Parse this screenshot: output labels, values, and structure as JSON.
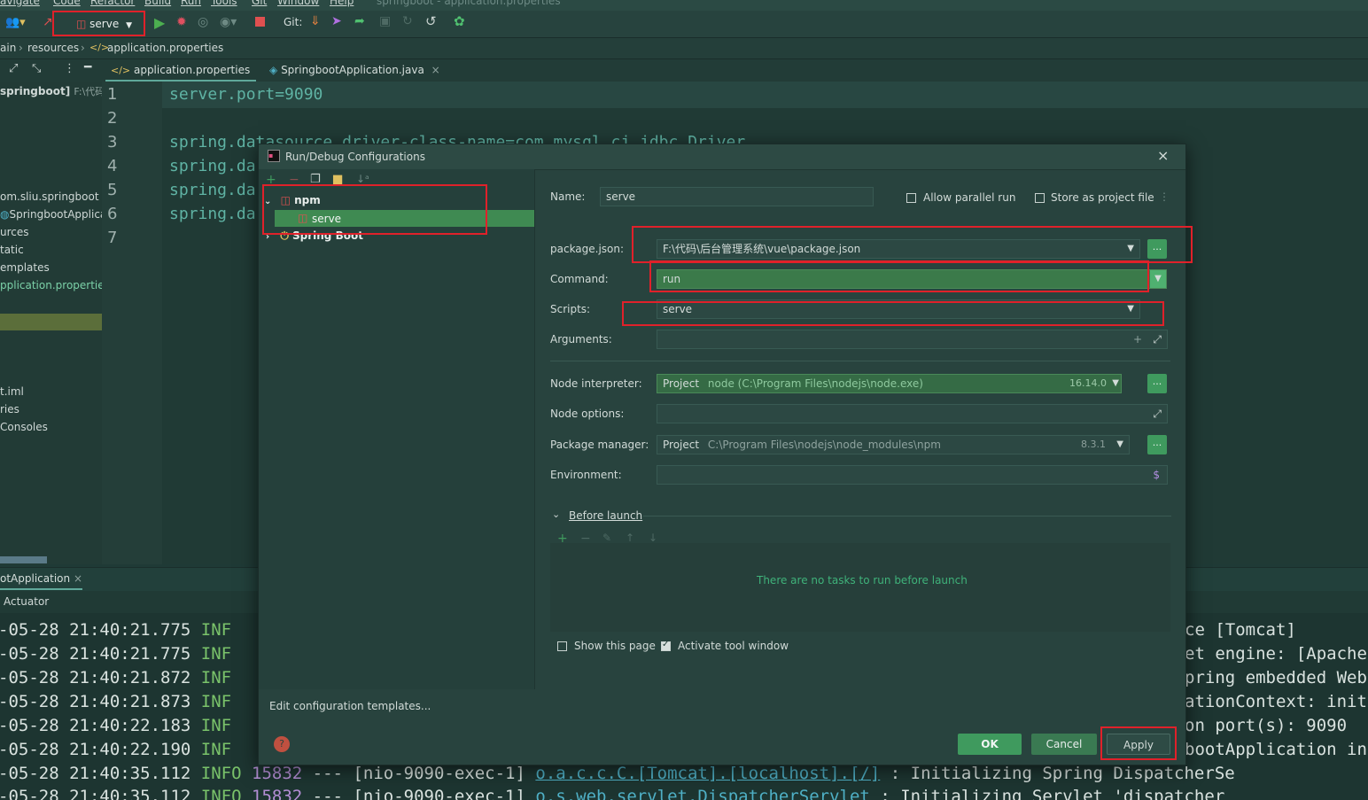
{
  "menubar": {
    "items": [
      "avigate",
      "Code",
      "Refactor",
      "Build",
      "Run",
      "Tools",
      "Git",
      "Window",
      "Help"
    ],
    "title": "springboot - application.properties"
  },
  "toolbar": {
    "run_config": "serve",
    "git_label": "Git:"
  },
  "breadcrumb": [
    "ain",
    "resources",
    "application.properties"
  ],
  "editor_tabs": [
    {
      "label": "application.properties",
      "active": true
    },
    {
      "label": "SpringbootApplication.java",
      "active": false
    }
  ],
  "project_tree": {
    "root": "springboot]",
    "root_path": "F:\\代码",
    "items": [
      "om.sliu.springboot",
      "SpringbootApplica",
      "urces",
      "tatic",
      "emplates",
      "pplication.propertie",
      "t.iml",
      "ries",
      " Consoles"
    ]
  },
  "editor": {
    "line_numbers": [
      "1",
      "2",
      "3",
      "4",
      "5",
      "6",
      "7"
    ],
    "lines": [
      "server.port=9090",
      "",
      "spring.datasource.driver-class-name=com.mysql.cj.jdbc.Driver",
      "spring.da",
      "spring.da",
      "spring.da",
      ""
    ]
  },
  "run_panel": {
    "tab": "otApplication",
    "subtab": "Actuator",
    "log": [
      {
        "time": "-05-28 21:40:21.775",
        "level": "INF",
        "right": "ce [Tomcat]"
      },
      {
        "time": "-05-28 21:40:21.775",
        "level": "INF",
        "right": "et engine: [Apache"
      },
      {
        "time": "-05-28 21:40:21.872",
        "level": "INF",
        "right": "pring embedded Web"
      },
      {
        "time": "-05-28 21:40:21.873",
        "level": "INF",
        "right": "ationContext: init"
      },
      {
        "time": "-05-28 21:40:22.183",
        "level": "INF",
        "right": " on port(s): 9090"
      },
      {
        "time": "-05-28 21:40:22.190",
        "level": "INF",
        "right": "bootApplication in"
      }
    ],
    "log_full": [
      {
        "time": "-05-28 21:40:35.112",
        "level": "INFO",
        "pid": "15832",
        "sep": "---",
        "thread": "[nio-9090-exec-1]",
        "logger": "o.a.c.c.C.[Tomcat].[localhost].[/]",
        "msg": ": Initializing Spring DispatcherSe"
      },
      {
        "time": "-05-28 21:40:35.112",
        "level": "INFO",
        "pid": "15832",
        "sep": "---",
        "thread": "[nio-9090-exec-1]",
        "logger": "o.s.web.servlet.DispatcherServlet",
        "msg": ": Initializing Servlet 'dispatcher"
      }
    ]
  },
  "dialog": {
    "title": "Run/Debug Configurations",
    "tree": {
      "npm": "npm",
      "serve": "serve",
      "spring_boot": "Spring Boot"
    },
    "edit_templates": "Edit configuration templates...",
    "name_label": "Name:",
    "name_value": "serve",
    "allow_parallel": "Allow parallel run",
    "store_project": "Store as project file",
    "package_json_label": "package.json:",
    "package_json_value": "F:\\代码\\后台管理系统\\vue\\package.json",
    "command_label": "Command:",
    "command_value": "run",
    "scripts_label": "Scripts:",
    "scripts_value": "serve",
    "arguments_label": "Arguments:",
    "node_interp_label": "Node interpreter:",
    "node_interp_project": "Project",
    "node_interp_path": "node (C:\\Program Files\\nodejs\\node.exe)",
    "node_interp_version": "16.14.0",
    "node_options_label": "Node options:",
    "pkg_mgr_label": "Package manager:",
    "pkg_mgr_project": "Project",
    "pkg_mgr_path": "C:\\Program Files\\nodejs\\node_modules\\npm",
    "pkg_mgr_version": "8.3.1",
    "environment_label": "Environment:",
    "before_launch": "Before launch",
    "no_tasks": "There are no tasks to run before launch",
    "show_page": "Show this page",
    "activate_window": "Activate tool window",
    "ok": "OK",
    "cancel": "Cancel",
    "apply": "Apply",
    "dots": "...",
    "dollar": "$"
  },
  "colors": {
    "accent": "#3f9a5e",
    "highlight": "#e0212a",
    "selection": "#3f8a52"
  }
}
